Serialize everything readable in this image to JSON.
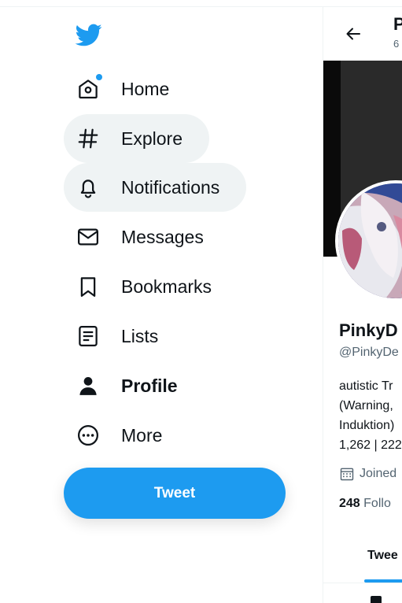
{
  "sidebar": {
    "items": [
      {
        "label": "Home",
        "icon": "home-icon",
        "has_badge": true
      },
      {
        "label": "Explore",
        "icon": "hashtag-icon"
      },
      {
        "label": "Notifications",
        "icon": "bell-icon"
      },
      {
        "label": "Messages",
        "icon": "envelope-icon"
      },
      {
        "label": "Bookmarks",
        "icon": "bookmark-icon"
      },
      {
        "label": "Lists",
        "icon": "list-icon"
      },
      {
        "label": "Profile",
        "icon": "person-icon",
        "active": true
      },
      {
        "label": "More",
        "icon": "more-circle-icon"
      }
    ],
    "tweet_label": "Tweet"
  },
  "profile": {
    "header_title": "P",
    "header_sub": "6",
    "display_name": "PinkyD",
    "handle": "@PinkyDe",
    "bio_lines": [
      "autistic Tr",
      "(Warning,",
      "Induktion)",
      "1,262 | 222"
    ],
    "joined": "Joined",
    "following_count": "248",
    "following_label": "Follo",
    "tab_label": "Twee"
  },
  "colors": {
    "accent": "#1d9bf0",
    "text": "#0f1419",
    "muted": "#536471",
    "hover_bg": "#eff3f4"
  }
}
